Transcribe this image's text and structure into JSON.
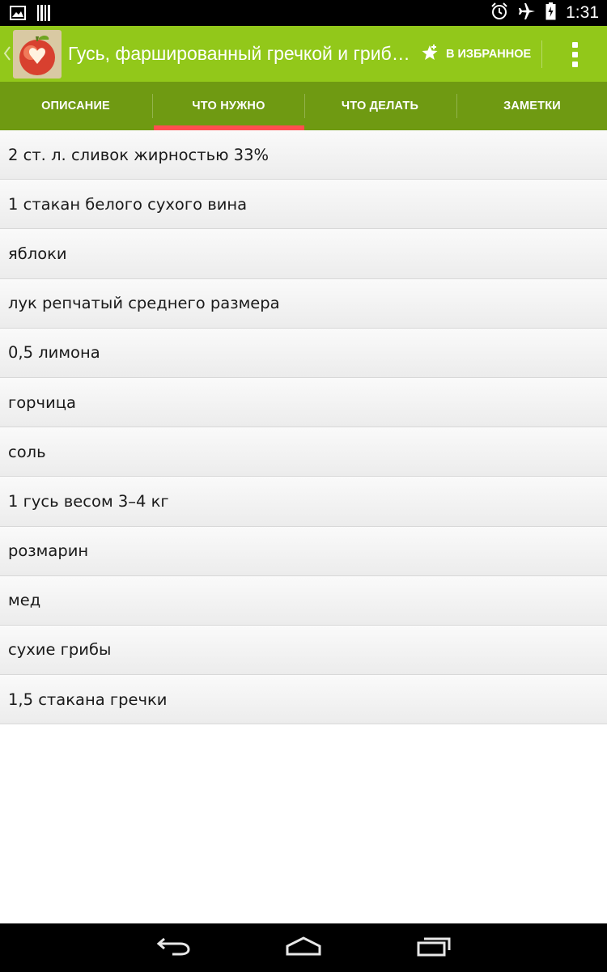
{
  "status_bar": {
    "time": "1:31",
    "icons_left": [
      "image-icon",
      "barcode-icon"
    ],
    "icons_right": [
      "alarm-icon",
      "airplane-icon",
      "battery-icon"
    ]
  },
  "action_bar": {
    "title": "Гусь, фаршированный гречкой и гриб…",
    "favorite_label": "В ИЗБРАННОЕ",
    "color": "#92c81a"
  },
  "tabs": [
    {
      "label": "ОПИСАНИЕ",
      "active": false
    },
    {
      "label": "ЧТО НУЖНО",
      "active": true
    },
    {
      "label": "ЧТО ДЕЛАТЬ",
      "active": false
    },
    {
      "label": "ЗАМЕТКИ",
      "active": false
    }
  ],
  "tab_bar_color": "#6f9a12",
  "active_tab_indicator_color": "#ff4f4f",
  "ingredients": [
    "2 ст. л. сливок жирностью 33%",
    "1 стакан белого сухого вина",
    "яблоки",
    "лук репчатый среднего размера",
    "0,5 лимона",
    "горчица",
    "соль",
    "1 гусь весом 3–4 кг",
    "розмарин",
    "мед",
    "сухие грибы",
    "1,5 стакана гречки"
  ],
  "nav_bar": {
    "buttons": [
      "back-icon",
      "home-icon",
      "recent-apps-icon"
    ]
  }
}
